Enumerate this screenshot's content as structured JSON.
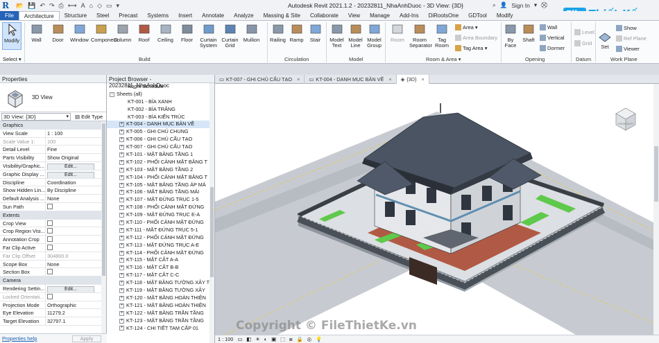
{
  "app": {
    "title": "Autodesk Revit 2021.1.2 - 20232811_NhaAnhDuoc - 3D View: {3D}",
    "sign_in": "Sign In",
    "brand_box": "File",
    "brand_text": "Thiết Kế.vn"
  },
  "tabs": [
    "File",
    "Architecture",
    "Structure",
    "Steel",
    "Precast",
    "Systems",
    "Insert",
    "Annotate",
    "Analyze",
    "Massing & Site",
    "Collaborate",
    "View",
    "Manage",
    "Add-Ins",
    "DiRootsOne",
    "GDTool",
    "Modify"
  ],
  "active_tab": "Architecture",
  "ribbon": {
    "modify": "Modify",
    "select": "Select ▾",
    "build_tools": [
      "Wall",
      "Door",
      "Window",
      "Component",
      "Column",
      "Roof",
      "Ceiling",
      "Floor",
      "Curtain System",
      "Curtain Grid",
      "Mullion"
    ],
    "circulation_tools": [
      "Railing",
      "Ramp",
      "Stair"
    ],
    "model_tools": [
      "Model Text",
      "Model Line",
      "Model Group"
    ],
    "room_tools": [
      "Room",
      "Room Separator",
      "Tag Room"
    ],
    "room_small": [
      "Area ▾",
      "Area Boundary",
      "Tag Area ▾"
    ],
    "opening_tools": [
      "By Face",
      "Shaft"
    ],
    "opening_small": [
      "Wall",
      "Vertical",
      "Dormer"
    ],
    "datum_tools": [
      "Level",
      "Grid"
    ],
    "workplane_tools": [
      "Set"
    ],
    "workplane_small": [
      "Show",
      "Ref Plane",
      "Viewer"
    ],
    "panels": [
      "Build",
      "Circulation",
      "Model",
      "Room & Area ▾",
      "Opening",
      "Datum",
      "Work Plane"
    ]
  },
  "properties": {
    "title": "Properties",
    "type_name": "3D View",
    "view_selector": "3D View: {3D}",
    "edit_type": "Edit Type",
    "rows": [
      {
        "k": "Graphics",
        "group": true
      },
      {
        "k": "View Scale",
        "v": "1 : 100"
      },
      {
        "k": "Scale Value    1:",
        "v": "100",
        "dim": true
      },
      {
        "k": "Detail Level",
        "v": "Fine"
      },
      {
        "k": "Parts Visibility",
        "v": "Show Original"
      },
      {
        "k": "Visibility/Graphic...",
        "btn": "Edit..."
      },
      {
        "k": "Graphic Display ...",
        "btn": "Edit..."
      },
      {
        "k": "Discipline",
        "v": "Coordination"
      },
      {
        "k": "Show Hidden Lin...",
        "v": "By Discipline"
      },
      {
        "k": "Default Analysis ...",
        "v": "None"
      },
      {
        "k": "Sun Path",
        "chk": true
      },
      {
        "k": "Extents",
        "group": true
      },
      {
        "k": "Crop View",
        "chk": true
      },
      {
        "k": "Crop Region Visi...",
        "chk": true
      },
      {
        "k": "Annotation Crop",
        "chk": true
      },
      {
        "k": "Far Clip Active",
        "chk": true
      },
      {
        "k": "Far Clip Offset",
        "v": "304800.0",
        "dim": true
      },
      {
        "k": "Scope Box",
        "v": "None"
      },
      {
        "k": "Section Box",
        "chk": true
      },
      {
        "k": "Camera",
        "group": true
      },
      {
        "k": "Rendering Settin...",
        "btn": "Edit..."
      },
      {
        "k": "Locked Orientati...",
        "chk": true,
        "dim": true
      },
      {
        "k": "Projection Mode",
        "v": "Orthographic"
      },
      {
        "k": "Eye Elevation",
        "v": "11279.2"
      },
      {
        "k": "Target Elevation",
        "v": "32797.1"
      }
    ],
    "help": "Properties help",
    "apply": "Apply"
  },
  "browser": {
    "title": "Project Browser - 20232811_NhaAnhDuoc",
    "items": [
      {
        "t": "Room Schedule",
        "lvl": "lvl1b"
      },
      {
        "t": "Sheets (all)",
        "lvl": "lvl0",
        "exp": "−"
      },
      {
        "t": "KT-001 - BÌA XANH",
        "lvl": "lvl1b"
      },
      {
        "t": "KT-002 - BÌA TRẮNG",
        "lvl": "lvl1b"
      },
      {
        "t": "KT-003 - BÌA KIẾN TRÚC",
        "lvl": "lvl1b"
      },
      {
        "t": "KT-004 - DANH MỤC BẢN VẼ",
        "lvl": "lvl1",
        "exp": "+",
        "sel": true
      },
      {
        "t": "KT-005 - GHI CHÚ CHUNG",
        "lvl": "lvl1",
        "exp": "+"
      },
      {
        "t": "KT-006 - GHI CHÚ CẤU TẠO",
        "lvl": "lvl1",
        "exp": "+"
      },
      {
        "t": "KT-007 - GHI CHÚ CẤU TẠO",
        "lvl": "lvl1",
        "exp": "+"
      },
      {
        "t": "KT-101 - MẶT BẰNG TẦNG 1",
        "lvl": "lvl1",
        "exp": "+"
      },
      {
        "t": "KT-102 - PHỐI CẢNH MẶT BẰNG T",
        "lvl": "lvl1",
        "exp": "+"
      },
      {
        "t": "KT-103 - MẶT BẰNG TẦNG 2",
        "lvl": "lvl1",
        "exp": "+"
      },
      {
        "t": "KT-104 - PHỐI CẢNH MẶT BẰNG T",
        "lvl": "lvl1",
        "exp": "+"
      },
      {
        "t": "KT-105 - MẶT BẰNG TẦNG ÁP MÁ",
        "lvl": "lvl1",
        "exp": "+"
      },
      {
        "t": "KT-106 - MẶT BẰNG TẦNG MÁI",
        "lvl": "lvl1",
        "exp": "+"
      },
      {
        "t": "KT-107 - MẶT ĐỨNG TRỤC 1-5",
        "lvl": "lvl1",
        "exp": "+"
      },
      {
        "t": "KT-108 - PHỐI CẢNH MẶT ĐỨNG",
        "lvl": "lvl1",
        "exp": "+"
      },
      {
        "t": "KT-109 - MẶT ĐỨNG TRỤC E-A",
        "lvl": "lvl1",
        "exp": "+"
      },
      {
        "t": "KT-110 - PHỐI CẢNH MẶT ĐỨNG",
        "lvl": "lvl1",
        "exp": "+"
      },
      {
        "t": "KT-111 - MẶT ĐỨNG TRỤC 5-1",
        "lvl": "lvl1",
        "exp": "+"
      },
      {
        "t": "KT-112 - PHỐI CẢNH MẶT ĐỨNG",
        "lvl": "lvl1",
        "exp": "+"
      },
      {
        "t": "KT-113 - MẶT ĐỨNG TRỤC A-E",
        "lvl": "lvl1",
        "exp": "+"
      },
      {
        "t": "KT-114 - PHỐI CẢNH MẶT ĐỨNG",
        "lvl": "lvl1",
        "exp": "+"
      },
      {
        "t": "KT-115 - MẶT CẮT A-A",
        "lvl": "lvl1",
        "exp": "+"
      },
      {
        "t": "KT-116 - MẶT CẮT B-B",
        "lvl": "lvl1",
        "exp": "+"
      },
      {
        "t": "KT-117 - MẶT CẮT C-C",
        "lvl": "lvl1",
        "exp": "+"
      },
      {
        "t": "KT-118 - MẶT BẰNG TƯỜNG XÂY T",
        "lvl": "lvl1",
        "exp": "+"
      },
      {
        "t": "KT-119 - MẶT BẰNG TƯỜNG XÂY",
        "lvl": "lvl1",
        "exp": "+"
      },
      {
        "t": "KT-120 - MẶT BẰNG HOÀN THIỆN",
        "lvl": "lvl1",
        "exp": "+"
      },
      {
        "t": "KT-121 - MẶT BẰNG HOÀN THIỆN",
        "lvl": "lvl1",
        "exp": "+"
      },
      {
        "t": "KT-122 - MẶT BẰNG TRẦN TẦNG",
        "lvl": "lvl1",
        "exp": "+"
      },
      {
        "t": "KT-123 - MẶT BẰNG TRẦN TẦNG",
        "lvl": "lvl1",
        "exp": "+"
      },
      {
        "t": "KT-124 - CHI TIẾT TAM CẤP 01",
        "lvl": "lvl1",
        "exp": "+"
      }
    ]
  },
  "view_tabs": [
    {
      "label": "KT-007 - GHI CHÚ CẤU TẠO",
      "active": false
    },
    {
      "label": "KT-004 - DANH MỤC BẢN VẼ",
      "active": false
    },
    {
      "label": "{3D}",
      "active": true
    }
  ],
  "view_control": {
    "scale": "1 : 100"
  },
  "watermark": "Copyright © FileThietKe.vn",
  "colors": {
    "accent": "#2363b8",
    "roof": "#4a5463",
    "grass": "#5ec94b",
    "terrace": "#b05a45"
  }
}
